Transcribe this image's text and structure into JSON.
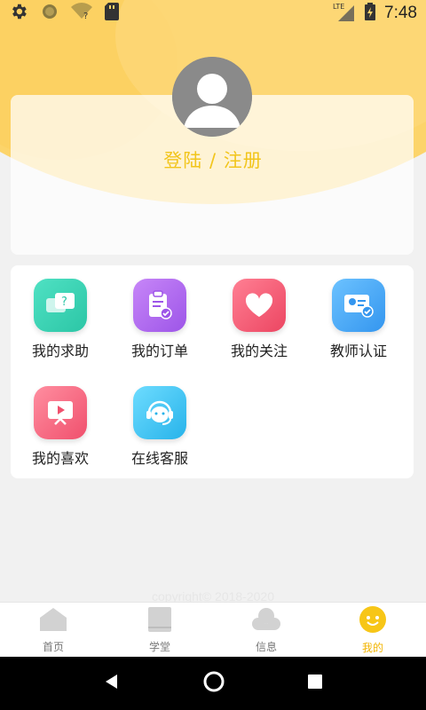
{
  "status_bar": {
    "time": "7:48",
    "network": "LTE",
    "icons": [
      "gear-icon",
      "circle-icon",
      "wifi-unknown-icon",
      "sd-card-icon",
      "signal-icon",
      "battery-charging-icon"
    ]
  },
  "profile": {
    "login_label": "登陆 / 注册",
    "avatar_icon": "default-avatar-icon"
  },
  "menu": {
    "items": [
      {
        "label": "我的求助",
        "icon": "help-chat-icon",
        "color": "#37d3b4"
      },
      {
        "label": "我的订单",
        "icon": "order-clipboard-icon",
        "color": "#b46cf0"
      },
      {
        "label": "我的关注",
        "icon": "heart-icon",
        "color": "#f35a72"
      },
      {
        "label": "教师认证",
        "icon": "teacher-id-card-icon",
        "color": "#43a7f5"
      },
      {
        "label": "我的喜欢",
        "icon": "video-play-icon",
        "color": "#f4607a"
      },
      {
        "label": "在线客服",
        "icon": "customer-service-icon",
        "color": "#33c2f0"
      }
    ]
  },
  "footer": {
    "watermark": "copyright© 2018-2020"
  },
  "tab_bar": {
    "tabs": [
      {
        "label": "首页",
        "icon": "home-icon",
        "active": false
      },
      {
        "label": "学堂",
        "icon": "book-icon",
        "active": false
      },
      {
        "label": "信息",
        "icon": "message-cloud-icon",
        "active": false
      },
      {
        "label": "我的",
        "icon": "smiley-face-icon",
        "active": true
      }
    ]
  },
  "colors": {
    "accent": "#f2c51c",
    "header_yellow": "#fcd46a",
    "tab_active": "#f2b400"
  }
}
